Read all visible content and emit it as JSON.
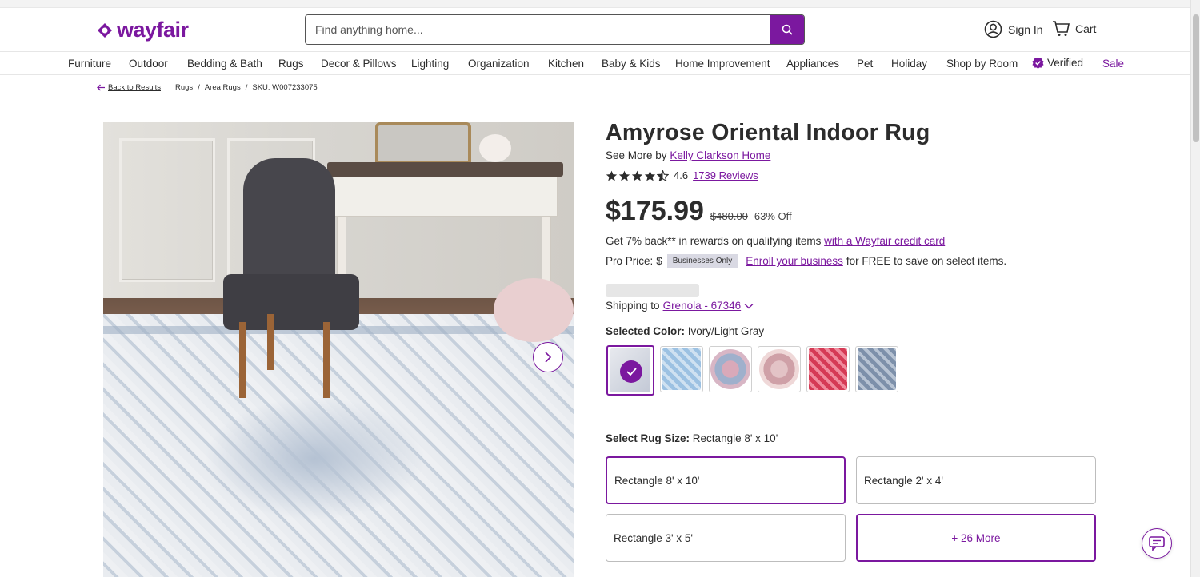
{
  "header": {
    "logo_text": "wayfair",
    "search_placeholder": "Find anything home...",
    "sign_in": "Sign In",
    "cart": "Cart"
  },
  "nav": {
    "items": [
      "Furniture",
      "Outdoor",
      "Bedding & Bath",
      "Rugs",
      "Decor & Pillows",
      "Lighting",
      "Organization",
      "Kitchen",
      "Baby & Kids",
      "Home Improvement",
      "Appliances",
      "Pet",
      "Holiday",
      "Shop by Room",
      "Verified",
      "Sale"
    ]
  },
  "breadcrumb": {
    "back": "Back to Results",
    "crumbs": [
      "Rugs",
      "Area Rugs"
    ],
    "sku": "SKU: W007233075"
  },
  "product": {
    "title": "Amyrose Oriental Indoor Rug",
    "see_more_prefix": "See More by",
    "brand": "Kelly Clarkson Home",
    "rating": "4.6",
    "rating_value": 4.6,
    "reviews": "1739 Reviews",
    "price": "$175.99",
    "list_price": "$480.00",
    "discount": "63% Off",
    "rewards_text": "Get 7% back** in rewards on qualifying items",
    "rewards_link": "with a Wayfair credit card",
    "pro_price_label": "Pro Price:",
    "pro_price_symbol": "$",
    "pro_badge": "Businesses Only",
    "enroll_link": "Enroll your business",
    "enroll_suffix": "for FREE to save on select items.",
    "shipping_prefix": "Shipping to",
    "shipping_location": "Grenola - 67346",
    "selected_color_label": "Selected Color:",
    "selected_color_value": "Ivory/Light Gray",
    "size_label": "Select Rug Size:",
    "size_value": "Rectangle 8' x 10'",
    "sizes": [
      "Rectangle 8' x 10'",
      "Rectangle 2' x 4'",
      "Rectangle 3' x 5'"
    ],
    "more_sizes": "+ 26 More"
  },
  "colors": {
    "brand": "#7b189f",
    "text": "#2c2c2c"
  }
}
